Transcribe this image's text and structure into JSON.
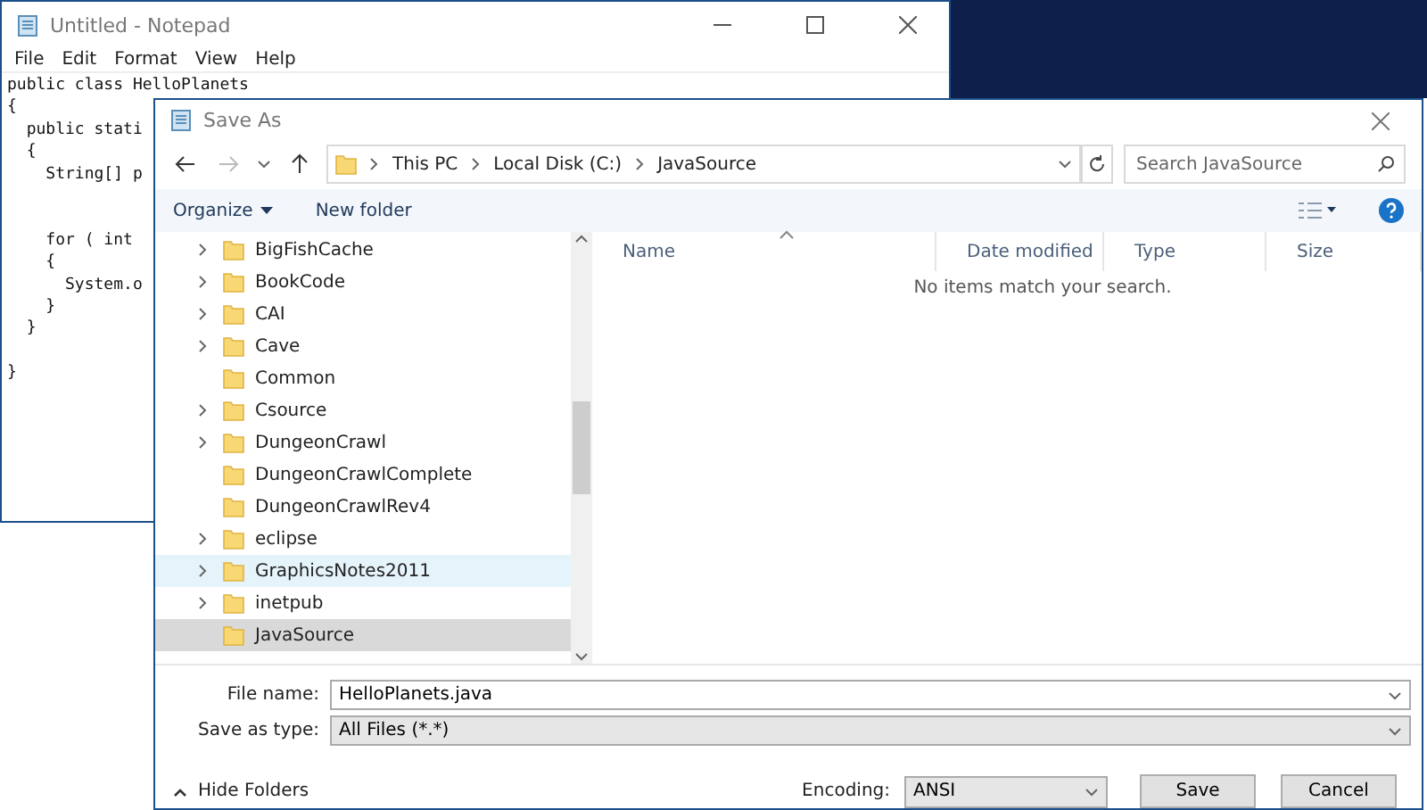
{
  "notepad": {
    "title": "Untitled - Notepad",
    "menu": [
      "File",
      "Edit",
      "Format",
      "View",
      "Help"
    ],
    "text": "public class HelloPlanets\n{\n  public stati\n  {\n    String[] p\n\n\n    for ( int\n    {\n      System.o\n    }\n  }\n\n}"
  },
  "dialog": {
    "title": "Save As",
    "breadcrumb": [
      "This PC",
      "Local Disk (C:)",
      "JavaSource"
    ],
    "search": {
      "placeholder": "Search JavaSource"
    },
    "toolbar": {
      "organize": "Organize",
      "new_folder": "New folder"
    },
    "tree": [
      {
        "label": "BigFishCache",
        "expandable": true,
        "hovered": false,
        "selected": false
      },
      {
        "label": "BookCode",
        "expandable": true,
        "hovered": false,
        "selected": false
      },
      {
        "label": "CAI",
        "expandable": true,
        "hovered": false,
        "selected": false
      },
      {
        "label": "Cave",
        "expandable": true,
        "hovered": false,
        "selected": false
      },
      {
        "label": "Common",
        "expandable": false,
        "hovered": false,
        "selected": false
      },
      {
        "label": "Csource",
        "expandable": true,
        "hovered": false,
        "selected": false
      },
      {
        "label": "DungeonCrawl",
        "expandable": true,
        "hovered": false,
        "selected": false
      },
      {
        "label": "DungeonCrawlComplete",
        "expandable": false,
        "hovered": false,
        "selected": false
      },
      {
        "label": "DungeonCrawlRev4",
        "expandable": false,
        "hovered": false,
        "selected": false
      },
      {
        "label": "eclipse",
        "expandable": true,
        "hovered": false,
        "selected": false
      },
      {
        "label": "GraphicsNotes2011",
        "expandable": true,
        "hovered": true,
        "selected": false
      },
      {
        "label": "inetpub",
        "expandable": true,
        "hovered": false,
        "selected": false
      },
      {
        "label": "JavaSource",
        "expandable": false,
        "hovered": false,
        "selected": true
      }
    ],
    "columns": [
      "Name",
      "Date modified",
      "Type",
      "Size"
    ],
    "empty_message": "No items match your search.",
    "file_name": {
      "label": "File name:",
      "value": "HelloPlanets.java"
    },
    "save_type": {
      "label": "Save as type:",
      "value": "All Files  (*.*)"
    },
    "hide_folders": "Hide Folders",
    "encoding": {
      "label": "Encoding:",
      "value": "ANSI"
    },
    "buttons": [
      "Save",
      "Cancel"
    ]
  }
}
